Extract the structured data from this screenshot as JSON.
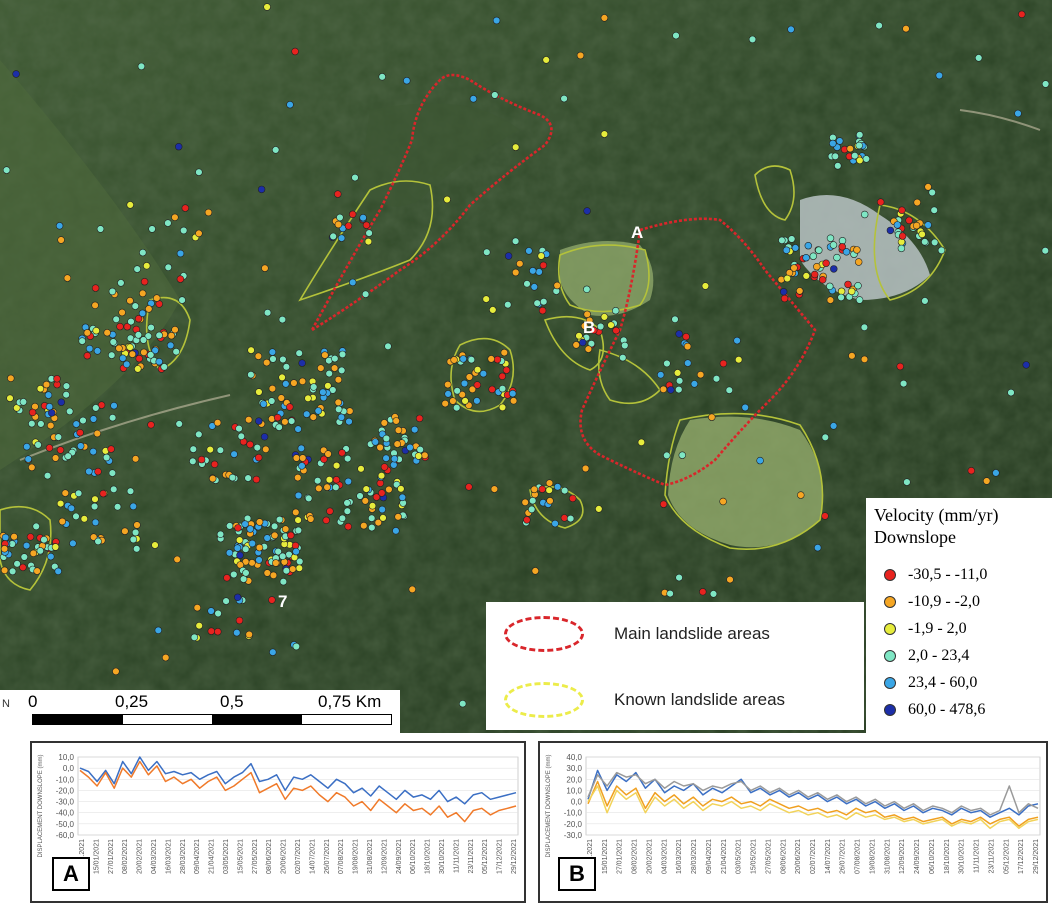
{
  "map": {
    "point_labels": [
      "A",
      "B",
      "7"
    ],
    "legend": {
      "title_line1": "Velocity (mm/yr)",
      "title_line2": "Downslope",
      "classes": [
        {
          "label": "-30,5 - -11,0",
          "color": "#e8231f"
        },
        {
          "label": "-10,9 - -2,0",
          "color": "#f5a623"
        },
        {
          "label": "-1,9 - 2,0",
          "color": "#e6ec3c"
        },
        {
          "label": "2,0 - 23,4",
          "color": "#7fe6c4"
        },
        {
          "label": "23,4 - 60,0",
          "color": "#3aa6e6"
        },
        {
          "label": "60,0 - 478,6",
          "color": "#1c2ea8"
        }
      ]
    },
    "area_legend": {
      "main": {
        "label": "Main landslide areas",
        "color": "#d9262b"
      },
      "known": {
        "label": "Known landslide areas",
        "color": "#ecec4a"
      }
    },
    "scalebar": {
      "labels": [
        "0",
        "0,25",
        "0,5",
        "0,75 Km"
      ],
      "north": "N"
    }
  },
  "chart_data": [
    {
      "type": "line",
      "tag": "A",
      "ylabel": "DISPLACEMENT DOWNSLOPE (mm)",
      "ylim": [
        -60,
        10
      ],
      "yticks": [
        "10,0",
        "0,0",
        "-10,0",
        "-20,0",
        "-30,0",
        "-40,0",
        "-50,0",
        "-60,0"
      ],
      "x": [
        "03.01.2021",
        "15/01/2021",
        "27/01/2021",
        "08/02/2021",
        "20/02/2021",
        "04/03/2021",
        "16/03/2021",
        "28/03/2021",
        "09/04/2021",
        "21/04/2021",
        "03/05/2021",
        "15/05/2021",
        "27/05/2021",
        "08/06/2021",
        "20/06/2021",
        "02/07/2021",
        "14/07/2021",
        "26/07/2021",
        "07/08/2021",
        "19/08/2021",
        "31/08/2021",
        "12/09/2021",
        "24/09/2021",
        "06/10/2021",
        "18/10/2021",
        "30/10/2021",
        "11/11/2021",
        "23/11/2021",
        "05/12/2021",
        "17/12/2021",
        "29/12/2021"
      ],
      "series": [
        {
          "color": "#3b6fc4",
          "values": [
            0,
            -3,
            -12,
            -2,
            -14,
            6,
            -5,
            10,
            -2,
            6,
            -5,
            -3,
            -6,
            -4,
            -10,
            -6,
            -3,
            -14,
            -8,
            -4,
            4,
            -12,
            -10,
            -6,
            -20,
            -8,
            -10,
            -6,
            -12,
            -18,
            -10,
            -14,
            -22,
            -18,
            -25,
            -16,
            -22,
            -28,
            -20,
            -26,
            -24,
            -28,
            -20,
            -30,
            -26,
            -32,
            -24,
            -22,
            -28,
            -26,
            -24,
            -22
          ]
        },
        {
          "color": "#f07a2a",
          "values": [
            -2,
            -8,
            -16,
            -4,
            -18,
            0,
            -8,
            6,
            -6,
            2,
            -12,
            -8,
            -14,
            -10,
            -18,
            -12,
            -8,
            -20,
            -16,
            -10,
            -4,
            -22,
            -18,
            -14,
            -28,
            -18,
            -20,
            -16,
            -24,
            -30,
            -22,
            -26,
            -34,
            -30,
            -38,
            -28,
            -34,
            -40,
            -32,
            -38,
            -36,
            -42,
            -34,
            -44,
            -40,
            -48,
            -38,
            -36,
            -42,
            -38,
            -36,
            -34
          ]
        }
      ]
    },
    {
      "type": "line",
      "tag": "B",
      "ylabel": "DISPLACEMENT DOWNSLOPE (mm)",
      "ylim": [
        -30,
        40
      ],
      "yticks": [
        "40,0",
        "30,0",
        "20,0",
        "10,0",
        "0,0",
        "-10,0",
        "-20,0",
        "-30,0"
      ],
      "x": [
        "03.01.2021",
        "15/01/2021",
        "27/01/2021",
        "08/02/2021",
        "20/02/2021",
        "04/03/2021",
        "16/03/2021",
        "28/03/2021",
        "09/04/2021",
        "21/04/2021",
        "03/05/2021",
        "15/05/2021",
        "27/05/2021",
        "08/06/2021",
        "20/06/2021",
        "02/07/2021",
        "14/07/2021",
        "26/07/2021",
        "07/08/2021",
        "19/08/2021",
        "31/08/2021",
        "12/09/2021",
        "24/09/2021",
        "06/10/2021",
        "18/10/2021",
        "30/10/2021",
        "11/11/2021",
        "23/11/2021",
        "05/12/2021",
        "17/12/2021",
        "29/12/2021"
      ],
      "series": [
        {
          "color": "#3b6fc4",
          "values": [
            2,
            28,
            10,
            24,
            18,
            26,
            12,
            20,
            8,
            14,
            10,
            16,
            6,
            12,
            8,
            14,
            20,
            8,
            12,
            6,
            10,
            4,
            8,
            2,
            6,
            0,
            4,
            -2,
            2,
            -4,
            0,
            -6,
            -2,
            -8,
            -4,
            -10,
            -6,
            -8,
            -12,
            -6,
            -10,
            -8,
            -14,
            -10,
            -6,
            -12,
            -4,
            -2
          ]
        },
        {
          "color": "#f0a020",
          "values": [
            -2,
            18,
            -4,
            14,
            6,
            12,
            -6,
            8,
            0,
            6,
            -2,
            4,
            -4,
            2,
            0,
            4,
            -2,
            0,
            -4,
            2,
            -2,
            -6,
            -4,
            -8,
            -6,
            -10,
            -8,
            -12,
            -6,
            -10,
            -8,
            -14,
            -12,
            -16,
            -14,
            -18,
            -16,
            -14,
            -20,
            -16,
            -18,
            -14,
            -20,
            -16,
            -14,
            -22,
            -16,
            -14
          ]
        },
        {
          "color": "#9a9a9a",
          "values": [
            4,
            24,
            14,
            26,
            22,
            24,
            16,
            20,
            12,
            18,
            14,
            16,
            10,
            14,
            12,
            16,
            18,
            10,
            14,
            8,
            12,
            6,
            10,
            4,
            8,
            2,
            6,
            0,
            4,
            -2,
            2,
            -4,
            0,
            -6,
            -2,
            -8,
            -4,
            -6,
            -10,
            -4,
            -8,
            -6,
            -12,
            -8,
            14,
            -10,
            -2,
            -6
          ]
        },
        {
          "color": "#f2d35a",
          "values": [
            0,
            14,
            -10,
            10,
            2,
            8,
            -10,
            4,
            -4,
            2,
            -6,
            0,
            -8,
            -2,
            -4,
            0,
            -6,
            -4,
            -8,
            -2,
            -6,
            -10,
            -8,
            -12,
            -10,
            -14,
            -12,
            -16,
            -10,
            -14,
            -12,
            -16,
            -14,
            -18,
            -16,
            -20,
            -18,
            -16,
            -22,
            -18,
            -20,
            -16,
            -24,
            -18,
            -16,
            -24,
            -18,
            -16
          ]
        }
      ]
    }
  ]
}
